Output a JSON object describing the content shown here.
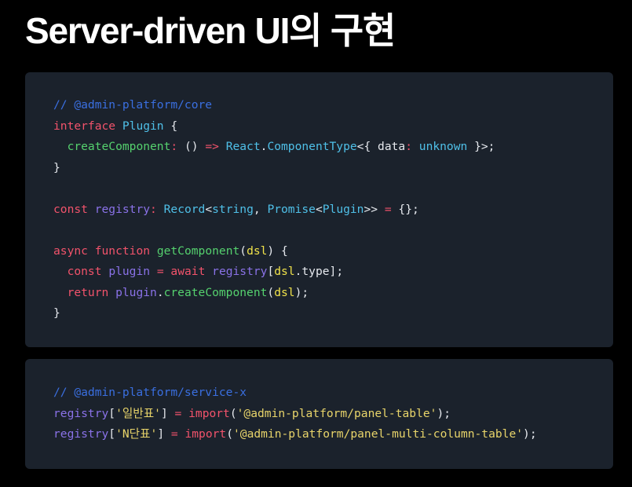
{
  "title": "Server-driven UI의 구현",
  "colors": {
    "background": "#000000",
    "code_bg": "#1b222c",
    "comment": "#3a6fe0",
    "keyword": "#f2536b",
    "type": "#4fc0e8",
    "function": "#55d16e",
    "variable": "#8a72e8",
    "param": "#f0e24a",
    "string": "#e8d46a",
    "plain": "#e6e9ee"
  },
  "code_blocks": [
    {
      "name": "core",
      "lines": [
        [
          [
            "comment",
            "// @admin-platform/core"
          ]
        ],
        [
          [
            "keyword",
            "interface"
          ],
          [
            "plain",
            " "
          ],
          [
            "type",
            "Plugin"
          ],
          [
            "plain",
            " {"
          ]
        ],
        [
          [
            "plain",
            "  "
          ],
          [
            "function",
            "createComponent"
          ],
          [
            "keyword",
            ":"
          ],
          [
            "plain",
            " () "
          ],
          [
            "keyword",
            "=>"
          ],
          [
            "plain",
            " "
          ],
          [
            "type",
            "React"
          ],
          [
            "plain",
            "."
          ],
          [
            "type",
            "ComponentType"
          ],
          [
            "plain",
            "<{ data"
          ],
          [
            "keyword",
            ":"
          ],
          [
            "plain",
            " "
          ],
          [
            "type",
            "unknown"
          ],
          [
            "plain",
            " }>;"
          ]
        ],
        [
          [
            "plain",
            "}"
          ]
        ],
        [],
        [
          [
            "keyword",
            "const"
          ],
          [
            "plain",
            " "
          ],
          [
            "variable",
            "registry"
          ],
          [
            "keyword",
            ":"
          ],
          [
            "plain",
            " "
          ],
          [
            "type",
            "Record"
          ],
          [
            "plain",
            "<"
          ],
          [
            "type",
            "string"
          ],
          [
            "plain",
            ", "
          ],
          [
            "type",
            "Promise"
          ],
          [
            "plain",
            "<"
          ],
          [
            "type",
            "Plugin"
          ],
          [
            "plain",
            ">> "
          ],
          [
            "keyword",
            "="
          ],
          [
            "plain",
            " {};"
          ]
        ],
        [],
        [
          [
            "keyword",
            "async"
          ],
          [
            "plain",
            " "
          ],
          [
            "keyword",
            "function"
          ],
          [
            "plain",
            " "
          ],
          [
            "function",
            "getComponent"
          ],
          [
            "plain",
            "("
          ],
          [
            "param",
            "dsl"
          ],
          [
            "plain",
            ") {"
          ]
        ],
        [
          [
            "plain",
            "  "
          ],
          [
            "keyword",
            "const"
          ],
          [
            "plain",
            " "
          ],
          [
            "variable",
            "plugin"
          ],
          [
            "plain",
            " "
          ],
          [
            "keyword",
            "="
          ],
          [
            "plain",
            " "
          ],
          [
            "keyword",
            "await"
          ],
          [
            "plain",
            " "
          ],
          [
            "variable",
            "registry"
          ],
          [
            "plain",
            "["
          ],
          [
            "param",
            "dsl"
          ],
          [
            "plain",
            ".type];"
          ]
        ],
        [
          [
            "plain",
            "  "
          ],
          [
            "keyword",
            "return"
          ],
          [
            "plain",
            " "
          ],
          [
            "variable",
            "plugin"
          ],
          [
            "plain",
            "."
          ],
          [
            "function",
            "createComponent"
          ],
          [
            "plain",
            "("
          ],
          [
            "param",
            "dsl"
          ],
          [
            "plain",
            ");"
          ]
        ],
        [
          [
            "plain",
            "}"
          ]
        ]
      ]
    },
    {
      "name": "service-x",
      "lines": [
        [
          [
            "comment",
            "// @admin-platform/service-x"
          ]
        ],
        [
          [
            "variable",
            "registry"
          ],
          [
            "plain",
            "["
          ],
          [
            "string",
            "'일반표'"
          ],
          [
            "plain",
            "] "
          ],
          [
            "keyword",
            "="
          ],
          [
            "plain",
            " "
          ],
          [
            "keyword",
            "import"
          ],
          [
            "plain",
            "("
          ],
          [
            "string",
            "'@admin-platform/panel-table'"
          ],
          [
            "plain",
            ");"
          ]
        ],
        [
          [
            "variable",
            "registry"
          ],
          [
            "plain",
            "["
          ],
          [
            "string",
            "'N단표'"
          ],
          [
            "plain",
            "] "
          ],
          [
            "keyword",
            "="
          ],
          [
            "plain",
            " "
          ],
          [
            "keyword",
            "import"
          ],
          [
            "plain",
            "("
          ],
          [
            "string",
            "'@admin-platform/panel-multi-column-table'"
          ],
          [
            "plain",
            ");"
          ]
        ]
      ]
    }
  ]
}
